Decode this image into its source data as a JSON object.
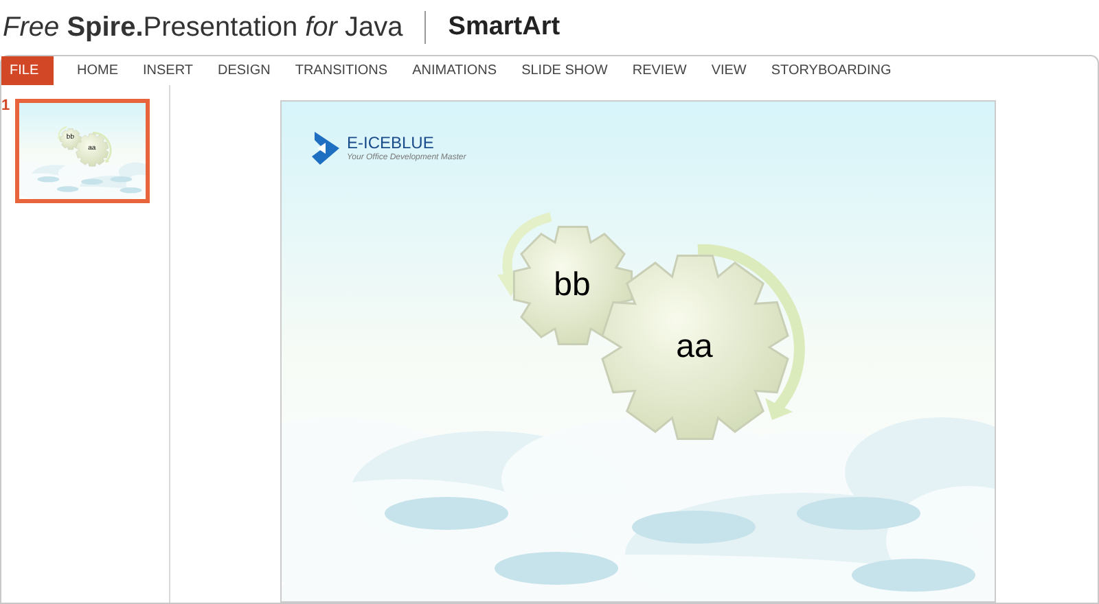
{
  "header": {
    "product": "*Free* **Spire.**Presentation *for* Java",
    "title": "SmartArt"
  },
  "tabs": [
    {
      "label": "FILE",
      "selected": true
    },
    {
      "label": "HOME",
      "selected": false
    },
    {
      "label": "INSERT",
      "selected": false
    },
    {
      "label": "DESIGN",
      "selected": false
    },
    {
      "label": "TRANSITIONS",
      "selected": false
    },
    {
      "label": "ANIMATIONS",
      "selected": false
    },
    {
      "label": "SLIDE SHOW",
      "selected": false
    },
    {
      "label": "REVIEW",
      "selected": false
    },
    {
      "label": "VIEW",
      "selected": false
    },
    {
      "label": "STORYBOARDING",
      "selected": false
    }
  ],
  "slides": [
    {
      "number": "1",
      "selected": true,
      "gear_labels": [
        "bb",
        "aa"
      ]
    }
  ],
  "slide": {
    "logo": {
      "name": "E-ICEBLUE",
      "tagline": "Your Office Development Master"
    },
    "gears": [
      {
        "label": "bb"
      },
      {
        "label": "aa"
      }
    ]
  }
}
